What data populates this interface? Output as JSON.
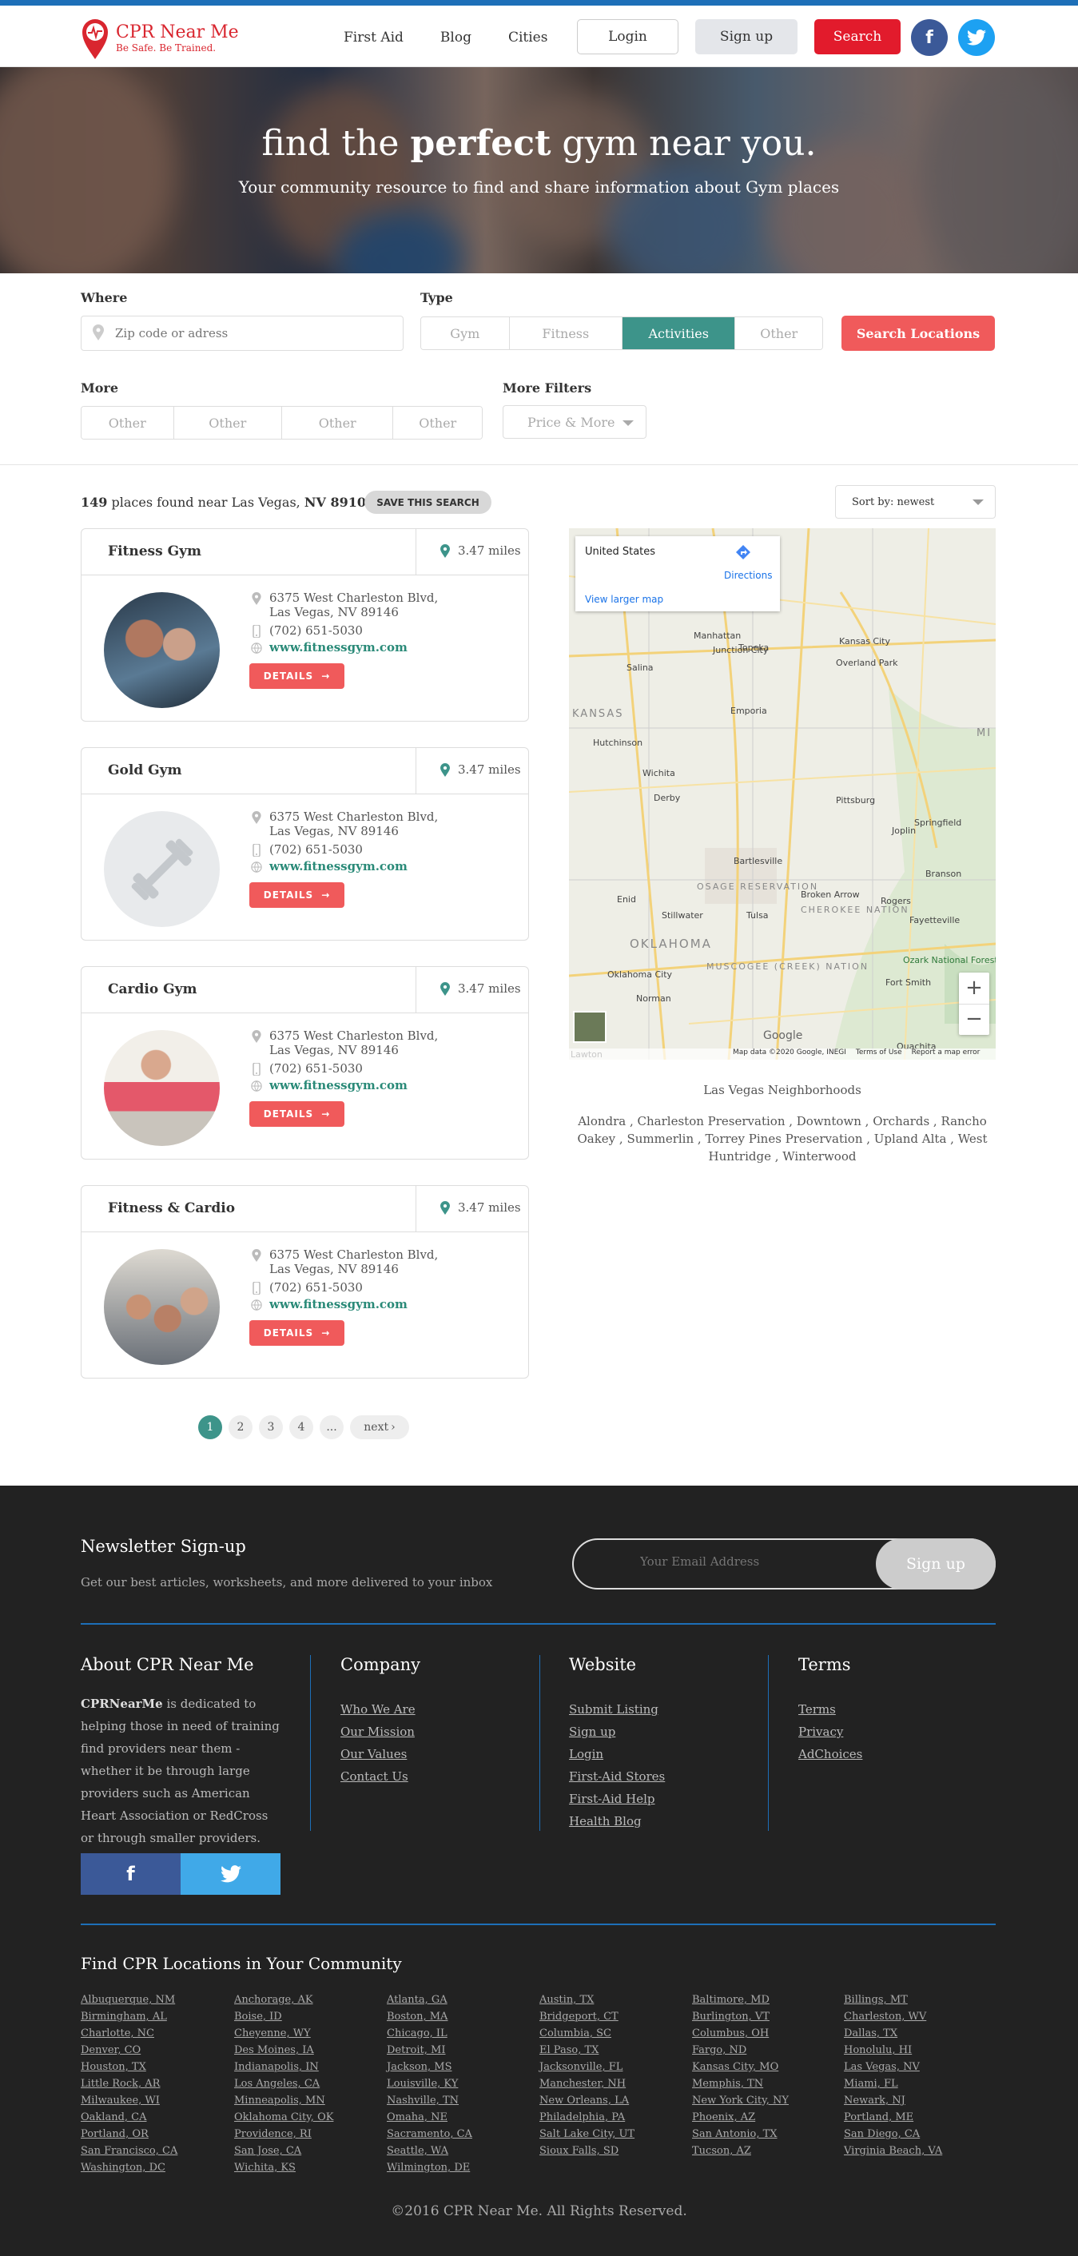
{
  "header": {
    "logo_name": "CPR Near Me",
    "logo_tagline": "Be Safe. Be Trained.",
    "nav": [
      "First Aid",
      "Blog",
      "Cities"
    ],
    "login_label": "Login",
    "signup_label": "Sign up",
    "search_label": "Search",
    "facebook_glyph": "f",
    "brand_color": "#d9262f"
  },
  "hero": {
    "title_pre": "find the ",
    "title_bold": "perfect",
    "title_post": " gym near you.",
    "subtitle": "Your community resource to find and share information about Gym places"
  },
  "filters": {
    "where_label": "Where",
    "where_placeholder": "Zip code or adress",
    "type_label": "Type",
    "type_options": [
      "Gym",
      "Fitness",
      "Activities",
      "Other"
    ],
    "type_selected": "Activities",
    "search_button": "Search Locations",
    "more_label": "More",
    "more_options": [
      "Other",
      "Other",
      "Other",
      "Other"
    ],
    "more_filters_label": "More Filters",
    "more_filters_value": "Price & More",
    "accent_color": "#3d948a"
  },
  "results": {
    "count": "149",
    "text_mid": " places found near Las Vegas, ",
    "zip": "NV 89103",
    "save_button": "SAVE THIS SEARCH",
    "sort_label": "Sort by: newest"
  },
  "listings": [
    {
      "name": "Fitness Gym",
      "distance": "3.47 miles",
      "address_1": "6375 West Charleston Blvd,",
      "address_2": "Las Vegas, NV 89146",
      "phone": "(702) 651-5030",
      "website": "www.fitnessgym.com",
      "details": "DETAILS"
    },
    {
      "name": "Gold Gym",
      "distance": "3.47 miles",
      "address_1": "6375 West Charleston Blvd,",
      "address_2": "Las Vegas, NV 89146",
      "phone": "(702) 651-5030",
      "website": "www.fitnessgym.com",
      "details": "DETAILS"
    },
    {
      "name": "Cardio Gym",
      "distance": "3.47 miles",
      "address_1": "6375 West Charleston Blvd,",
      "address_2": "Las Vegas, NV 89146",
      "phone": "(702) 651-5030",
      "website": "www.fitnessgym.com",
      "details": "DETAILS"
    },
    {
      "name": "Fitness & Cardio",
      "distance": "3.47 miles",
      "address_1": "6375 West Charleston Blvd,",
      "address_2": "Las Vegas, NV 89146",
      "phone": "(702) 651-5030",
      "website": "www.fitnessgym.com",
      "details": "DETAILS"
    }
  ],
  "map": {
    "region": "United States",
    "directions": "Directions",
    "larger_map": "View larger map",
    "cities": [
      "Kansas City",
      "Topeka",
      "Overland Park",
      "Manhattan",
      "Junction City",
      "Salina",
      "Emporia",
      "Hutchinson",
      "Wichita",
      "Derby",
      "Pittsburg",
      "Joplin",
      "Springfield",
      "Bartlesville",
      "Tulsa",
      "Enid",
      "Stillwater",
      "Broken Arrow",
      "Rogers",
      "Fayetteville",
      "Oklahoma City",
      "Norman",
      "Fort Smith",
      "Ozark National Forest",
      "Ouachita",
      "Lawton",
      "Branson"
    ],
    "region_labels": [
      "KANSAS",
      "OKLAHOMA",
      "OSAGE RESERVATION",
      "CHEROKEE NATION",
      "MUSCOGEE (CREEK) NATION",
      "MI"
    ],
    "zoom_in": "+",
    "zoom_out": "−",
    "google": "Google",
    "attribution": "Map data ©2020 Google, INEGI",
    "terms": "Terms of Use",
    "report": "Report a map error"
  },
  "neighborhoods": {
    "title": "Las Vegas Neighborhoods",
    "list": "Alondra , Charleston Preservation , Downtown , Orchards , Rancho Oakey , Summerlin , Torrey Pines Preservation , Upland Alta , West Huntridge , Winterwood"
  },
  "pagination": {
    "pages": [
      "1",
      "2",
      "3",
      "4",
      "..."
    ],
    "next": "next"
  },
  "footer": {
    "newsletter_title": "Newsletter Sign-up",
    "newsletter_sub": "Get our best articles, worksheets, and more delivered to your inbox",
    "email_placeholder": "Your Email Address",
    "signup_button": "Sign up",
    "about_title": "About CPR Near Me",
    "about_bold": "CPRNearMe",
    "about_text": " is dedicated to helping those in need of training find providers near them - whether it be through large providers such as American Heart Association or RedCross or through smaller providers.",
    "facebook_glyph": "f",
    "company_title": "Company",
    "company_links": [
      "Who We Are",
      "Our Mission",
      "Our Values",
      "Contact Us"
    ],
    "website_title": "Website",
    "website_links": [
      "Submit Listing",
      "Sign up",
      "Login",
      "First-Aid Stores",
      "First-Aid Help",
      "Health Blog"
    ],
    "terms_title": "Terms",
    "terms_links": [
      "Terms",
      "Privacy",
      "AdChoices"
    ],
    "cities_title": "Find CPR Locations in Your Community",
    "cities": [
      [
        "Albuquerque, NM",
        "Birmingham, AL",
        "Charlotte, NC",
        "Denver, CO",
        "Houston, TX",
        "Little Rock, AR",
        "Milwaukee, WI",
        "Oakland, CA",
        "Portland, OR",
        "San Francisco, CA",
        "Washington, DC"
      ],
      [
        "Anchorage, AK",
        "Boise, ID",
        "Cheyenne, WY",
        "Des Moines, IA",
        "Indianapolis, IN",
        "Los Angeles, CA",
        "Minneapolis, MN",
        "Oklahoma City, OK",
        "Providence, RI",
        "San Jose, CA",
        "Wichita, KS"
      ],
      [
        "Atlanta, GA",
        "Boston, MA",
        "Chicago, IL",
        "Detroit, MI",
        "Jackson, MS",
        "Louisville, KY",
        "Nashville, TN",
        "Omaha, NE",
        "Sacramento, CA",
        "Seattle, WA",
        "Wilmington, DE"
      ],
      [
        "Austin, TX",
        "Bridgeport, CT",
        "Columbia, SC",
        "El Paso, TX",
        "Jacksonville, FL",
        "Manchester, NH",
        "New Orleans, LA",
        "Philadelphia, PA",
        "Salt Lake City, UT",
        "Sioux Falls, SD"
      ],
      [
        "Baltimore, MD",
        "Burlington, VT",
        "Columbus, OH",
        "Fargo, ND",
        "Kansas City, MO",
        "Memphis, TN",
        "New York City, NY",
        "Phoenix, AZ",
        "San Antonio, TX",
        "Tucson, AZ"
      ],
      [
        "Billings, MT",
        "Charleston, WV",
        "Dallas, TX",
        "Honolulu, HI",
        "Las Vegas, NV",
        "Miami, FL",
        "Newark, NJ",
        "Portland, ME",
        "San Diego, CA",
        "Virginia Beach, VA"
      ]
    ],
    "copyright": "©2016 CPR Near Me. All Rights Reserved."
  }
}
